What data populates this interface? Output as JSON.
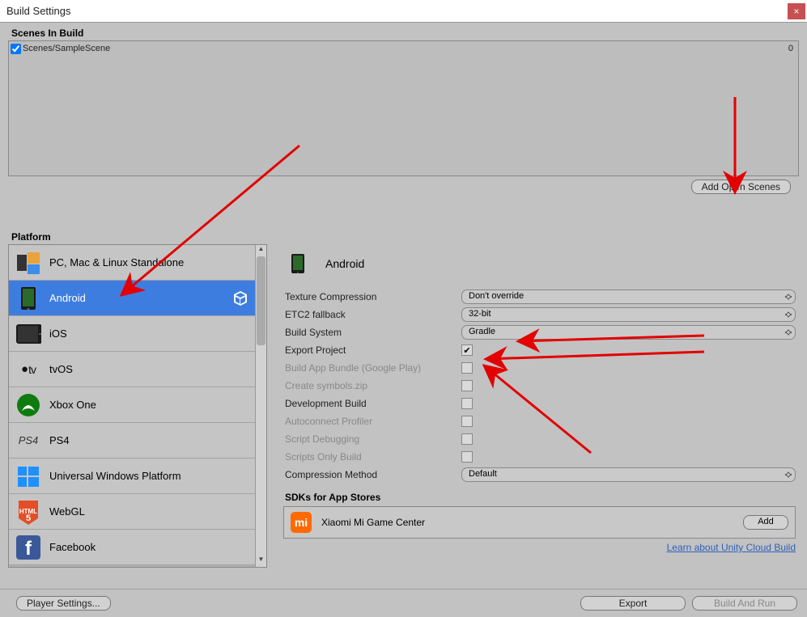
{
  "window": {
    "title": "Build Settings",
    "close": "×"
  },
  "scenes": {
    "header": "Scenes In Build",
    "items": [
      {
        "checked": true,
        "name": "Scenes/SampleScene",
        "index": "0"
      }
    ],
    "add_button": "Add Open Scenes"
  },
  "platform": {
    "header": "Platform",
    "items": [
      {
        "id": "standalone",
        "label": "PC, Mac & Linux Standalone",
        "selected": false
      },
      {
        "id": "android",
        "label": "Android",
        "selected": true,
        "current_target": true
      },
      {
        "id": "ios",
        "label": "iOS",
        "selected": false
      },
      {
        "id": "tvos",
        "label": "tvOS",
        "selected": false
      },
      {
        "id": "xboxone",
        "label": "Xbox One",
        "selected": false
      },
      {
        "id": "ps4",
        "label": "PS4",
        "selected": false
      },
      {
        "id": "uwp",
        "label": "Universal Windows Platform",
        "selected": false
      },
      {
        "id": "webgl",
        "label": "WebGL",
        "selected": false
      },
      {
        "id": "facebook",
        "label": "Facebook",
        "selected": false
      }
    ]
  },
  "details": {
    "title": "Android",
    "rows": [
      {
        "key": "texture_compression",
        "label": "Texture Compression",
        "type": "select",
        "value": "Don't override",
        "disabled": false
      },
      {
        "key": "etc2_fallback",
        "label": "ETC2 fallback",
        "type": "select",
        "value": "32-bit",
        "disabled": false
      },
      {
        "key": "build_system",
        "label": "Build System",
        "type": "select",
        "value": "Gradle",
        "disabled": false
      },
      {
        "key": "export_project",
        "label": "Export Project",
        "type": "checkbox",
        "value": true,
        "disabled": false
      },
      {
        "key": "build_app_bundle",
        "label": "Build App Bundle (Google Play)",
        "type": "checkbox",
        "value": false,
        "disabled": true
      },
      {
        "key": "create_symbols",
        "label": "Create symbols.zip",
        "type": "checkbox",
        "value": false,
        "disabled": true
      },
      {
        "key": "development_build",
        "label": "Development Build",
        "type": "checkbox",
        "value": false,
        "disabled": false
      },
      {
        "key": "autoconnect_profiler",
        "label": "Autoconnect Profiler",
        "type": "checkbox",
        "value": false,
        "disabled": true
      },
      {
        "key": "script_debugging",
        "label": "Script Debugging",
        "type": "checkbox",
        "value": false,
        "disabled": true
      },
      {
        "key": "scripts_only_build",
        "label": "Scripts Only Build",
        "type": "checkbox",
        "value": false,
        "disabled": true
      },
      {
        "key": "compression_method",
        "label": "Compression Method",
        "type": "select",
        "value": "Default",
        "disabled": false
      }
    ],
    "sdks_header": "SDKs for App Stores",
    "sdk": {
      "name": "Xiaomi Mi Game Center",
      "button": "Add"
    },
    "learn_link": "Learn about Unity Cloud Build"
  },
  "footer": {
    "player_settings": "Player Settings...",
    "export": "Export",
    "build_and_run": "Build And Run"
  }
}
